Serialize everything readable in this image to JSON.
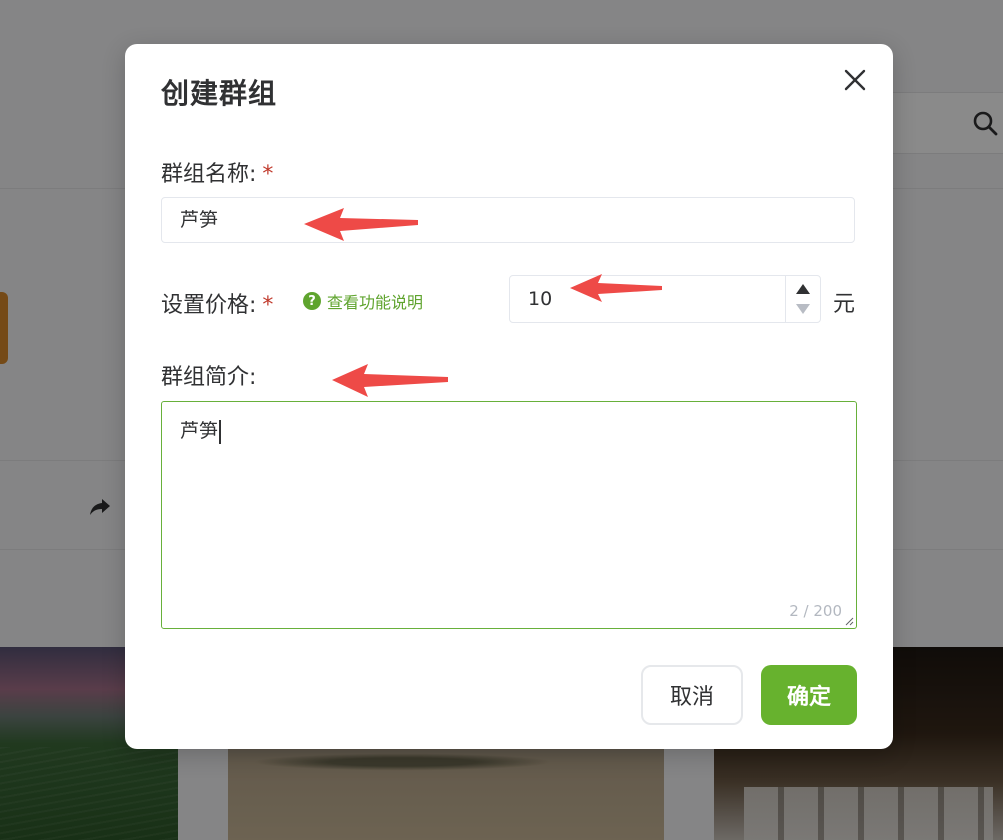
{
  "dialog": {
    "title": "创建群组",
    "close_icon": "close-icon"
  },
  "form": {
    "name": {
      "label": "群组名称:",
      "required_mark": "*",
      "value": "芦笋"
    },
    "price": {
      "label": "设置价格:",
      "required_mark": "*",
      "help_text": "查看功能说明",
      "help_icon": "question-circle-icon",
      "value": "10",
      "unit": "元"
    },
    "intro": {
      "label": "群组简介:",
      "value": "芦笋",
      "counter": "2 / 200"
    }
  },
  "buttons": {
    "cancel_label": "取消",
    "ok_label": "确定"
  },
  "colors": {
    "accent": "#67b22e",
    "required": "#c0392b",
    "annotation_arrow": "#ee4a47"
  }
}
